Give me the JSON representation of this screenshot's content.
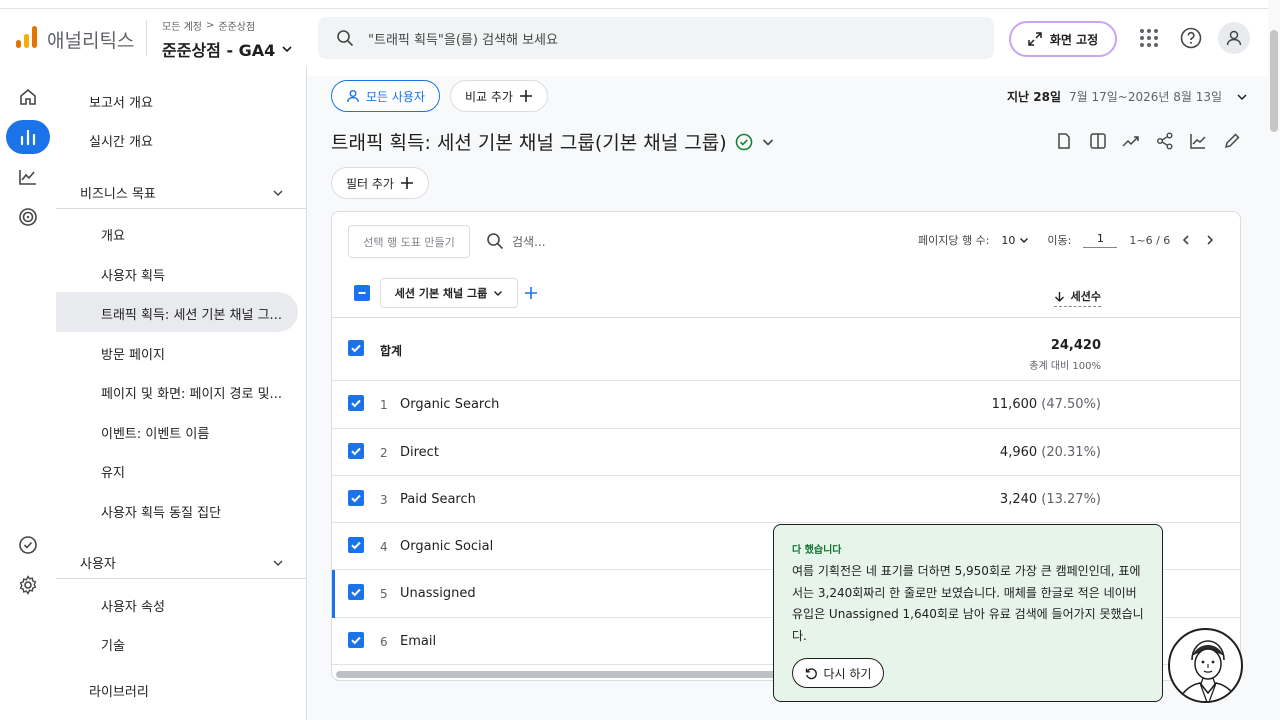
{
  "header": {
    "brand": "애널리틱스",
    "breadcrumb_account": "모든 계정",
    "breadcrumb_sep": ">",
    "breadcrumb_property": "준준상점",
    "property_name": "준준상점 - GA4",
    "search_placeholder": "\"트래픽 획득\"을(를) 검색해 보세요",
    "pin_label": "화면 고정"
  },
  "sidebar": {
    "overview": "보고서 개요",
    "realtime": "실시간 개요",
    "section_business": "비즈니스 목표",
    "business_items": [
      "개요",
      "사용자 획득",
      "트래픽 획득: 세션 기본 채널 그...",
      "방문 페이지",
      "페이지 및 화면: 페이지 경로 및...",
      "이벤트: 이벤트 이름",
      "유지",
      "사용자 획득 동질 집단"
    ],
    "section_user": "사용자",
    "user_items": [
      "사용자 속성",
      "기술"
    ],
    "library": "라이브러리"
  },
  "toolbar": {
    "all_users": "모든 사용자",
    "add_comparison": "비교 추가",
    "date_label": "지난 28일",
    "date_range": "7월 17일~2026년 8월 13일",
    "add_filter": "필터 추가"
  },
  "report": {
    "title": "트래픽 획득: 세션 기본 채널 그룹(기본 채널 그룹)"
  },
  "table": {
    "create_chart": "선택 행 도표 만들기",
    "search_placeholder": "검색...",
    "rows_per_page_label": "페이지당 행 수:",
    "rows_per_page": "10",
    "goto_label": "이동:",
    "page": "1",
    "range": "1~6 / 6",
    "dimension": "세션 기본 채널 그룹",
    "metric": "세션수",
    "total_label": "합계",
    "total_value": "24,420",
    "total_sub": "총계 대비 100%",
    "rows": [
      {
        "idx": "1",
        "name": "Organic Search",
        "value": "11,600",
        "pct": "(47.50%)"
      },
      {
        "idx": "2",
        "name": "Direct",
        "value": "4,960",
        "pct": "(20.31%)"
      },
      {
        "idx": "3",
        "name": "Paid Search",
        "value": "3,240",
        "pct": "(13.27%)"
      },
      {
        "idx": "4",
        "name": "Organic Social",
        "value": "",
        "pct": ""
      },
      {
        "idx": "5",
        "name": "Unassigned",
        "value": "",
        "pct": ""
      },
      {
        "idx": "6",
        "name": "Email",
        "value": "",
        "pct": ""
      }
    ]
  },
  "toast": {
    "title": "다 했습니다",
    "body": "여름 기획전은 네 표기를 더하면 5,950회로 가장 큰 캠페인인데, 표에서는 3,240회짜리 한 줄로만 보였습니다. 매체를 한글로 적은 네이버 유입은 Unassigned 1,640회로 남아 유료 검색에 들어가지 못했습니다.",
    "retry": "다시 하기"
  },
  "colors": {
    "accent": "#1a73e8",
    "toast_bg": "#e6f4ea",
    "success": "#137333"
  }
}
